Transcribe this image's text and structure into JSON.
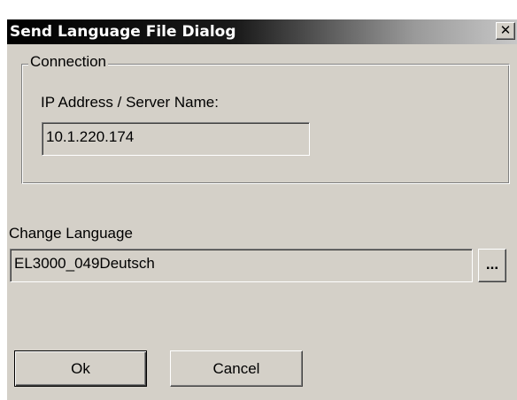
{
  "window": {
    "title": "Send Language File Dialog",
    "close_glyph": "✕"
  },
  "connection": {
    "group_label": "Connection",
    "ip_label": "IP Address / Server Name:",
    "ip_value": "10.1.220.174"
  },
  "language": {
    "label": "Change Language",
    "value": "EL3000_049Deutsch",
    "browse_label": "..."
  },
  "buttons": {
    "ok": "Ok",
    "cancel": "Cancel"
  },
  "colors": {
    "dialog_face": "#d4d0c8",
    "titlebar_start": "#000000",
    "titlebar_end": "#c8c8c8",
    "title_text": "#ffffff"
  }
}
